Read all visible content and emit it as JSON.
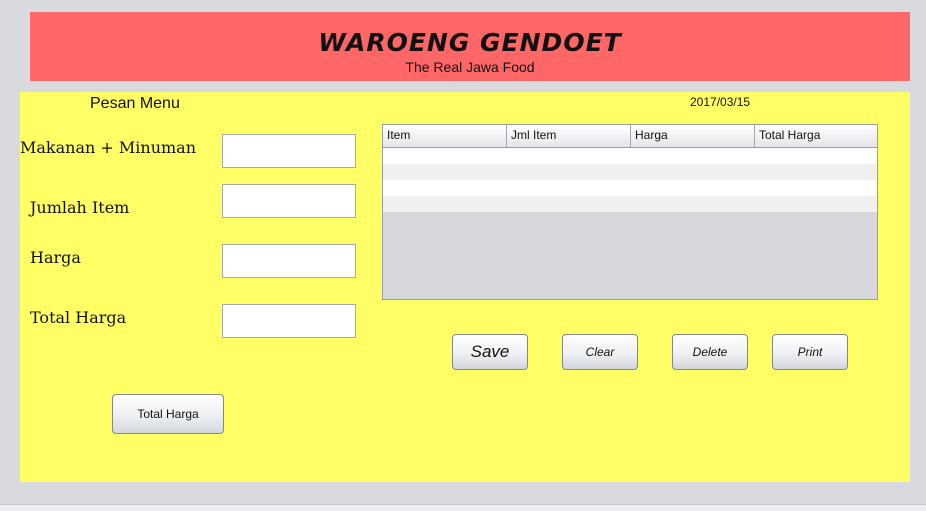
{
  "header": {
    "title": "WAROENG GENDOET",
    "subtitle": "The Real Jawa Food",
    "bg_color": "#ff6666"
  },
  "panel": {
    "title": "Pesan Menu",
    "date": "2017/03/15",
    "bg_color": "#ffff66"
  },
  "form": {
    "fields": [
      {
        "label": "Makanan + Minuman",
        "value": ""
      },
      {
        "label": "Jumlah Item",
        "value": ""
      },
      {
        "label": "Harga",
        "value": ""
      },
      {
        "label": "Total Harga",
        "value": ""
      }
    ]
  },
  "table": {
    "columns": [
      "Item",
      "Jml Item",
      "Harga",
      "Total Harga"
    ],
    "rows": []
  },
  "buttons": {
    "save": "Save",
    "clear": "Clear",
    "delete": "Delete",
    "print": "Print",
    "total_harga": "Total Harga"
  }
}
